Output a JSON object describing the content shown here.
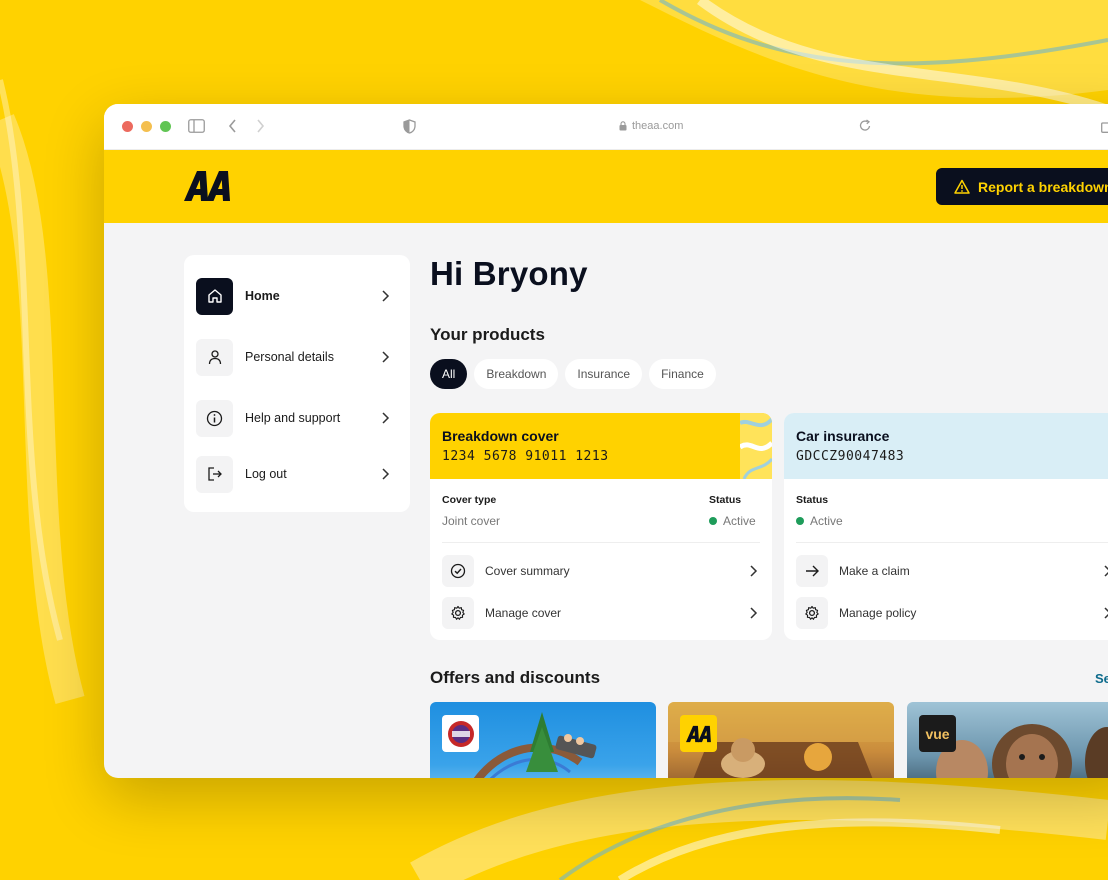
{
  "browser": {
    "url": "theaa.com"
  },
  "header": {
    "logo_text": "AA",
    "report_button_label": "Report a breakdown"
  },
  "sidebar": {
    "items": [
      {
        "label": "Home",
        "icon": "home-icon",
        "active": true
      },
      {
        "label": "Personal details",
        "icon": "person-icon",
        "active": false
      },
      {
        "label": "Help and support",
        "icon": "info-icon",
        "active": false
      },
      {
        "label": "Log out",
        "icon": "logout-icon",
        "active": false
      }
    ]
  },
  "main": {
    "greeting": "Hi Bryony",
    "products_title": "Your products",
    "filters": [
      {
        "label": "All",
        "active": true
      },
      {
        "label": "Breakdown",
        "active": false
      },
      {
        "label": "Insurance",
        "active": false
      },
      {
        "label": "Finance",
        "active": false
      }
    ],
    "cards": [
      {
        "name": "Breakdown cover",
        "number": "1234 5678 91011 1213",
        "header_color": "#ffd200",
        "info": [
          {
            "label": "Cover type",
            "value": "Joint cover"
          },
          {
            "label": "Status",
            "value": "Active"
          }
        ],
        "links": [
          {
            "label": "Cover summary",
            "icon": "check-circle-icon"
          },
          {
            "label": "Manage cover",
            "icon": "gear-icon"
          }
        ]
      },
      {
        "name": "Car insurance",
        "number": "GDCCZ90047483",
        "header_color": "#d9eef6",
        "info": [
          {
            "label": "Status",
            "value": "Active"
          }
        ],
        "links": [
          {
            "label": "Make a claim",
            "icon": "arrow-right-icon"
          },
          {
            "label": "Manage policy",
            "icon": "gear-icon"
          }
        ]
      }
    ],
    "offers_title": "Offers and discounts",
    "see_all_label": "Se",
    "offers": [
      {
        "badge": "Alton Towers",
        "badge_icon": "alton-towers-logo"
      },
      {
        "badge": "AA",
        "badge_icon": "aa-logo"
      },
      {
        "badge": "vue",
        "badge_icon": "vue-logo"
      }
    ]
  },
  "colors": {
    "brand_yellow": "#ffd200",
    "navy": "#0a0f1e",
    "status_green": "#1e9c5a"
  }
}
